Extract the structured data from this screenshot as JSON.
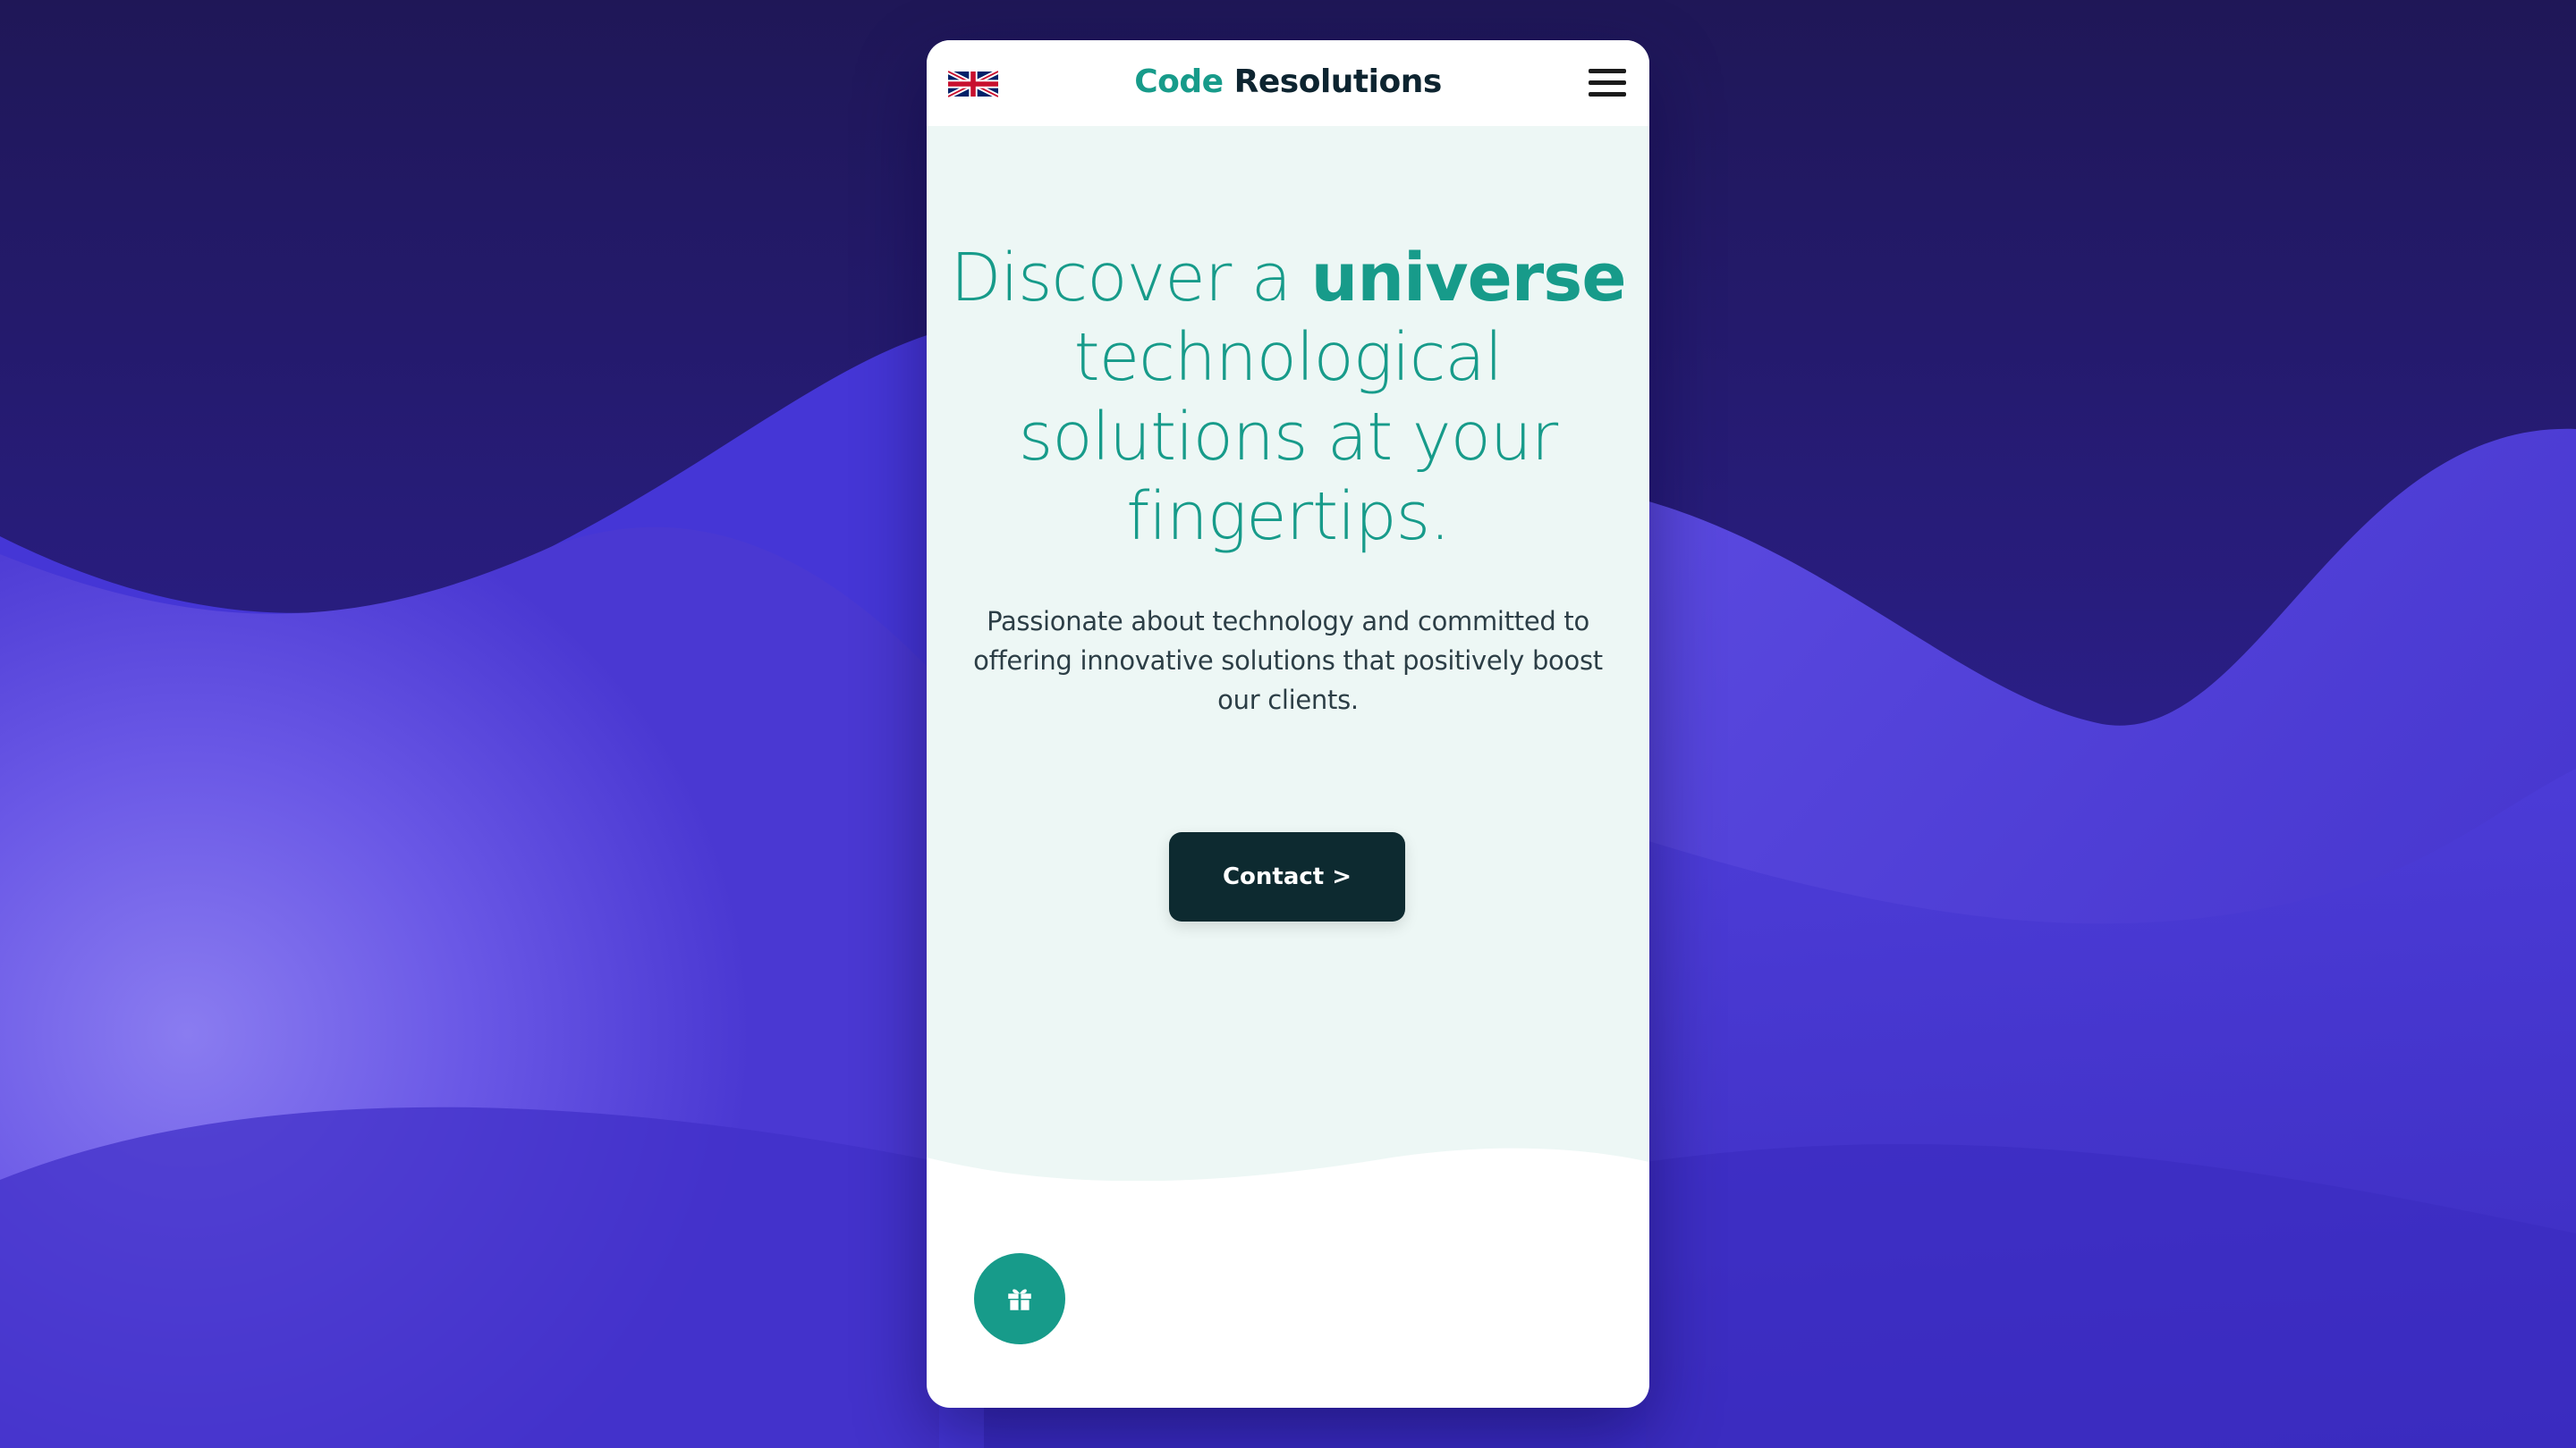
{
  "brand": {
    "word1": "Code",
    "word2": "Resolutions"
  },
  "header": {
    "language_flag_icon": "uk-flag-icon",
    "menu_icon": "hamburger-menu-icon"
  },
  "hero": {
    "headline": {
      "line1_regular": "Discover a ",
      "line1_bold": "universe",
      "line2": "technological",
      "line3": "solutions at your",
      "line4": "fingertips."
    },
    "description": {
      "line1": "Passionate about technology and committed to",
      "line2": "offering innovative solutions that positively boost",
      "line3": "our clients."
    },
    "cta_label": "Contact >"
  },
  "floating_action": {
    "icon": "gift-icon"
  },
  "colors": {
    "accent_teal": "#179b8a",
    "dark_navy": "#0d2a30",
    "hero_background": "#edf7f5",
    "page_background": "#3b2fcf"
  }
}
